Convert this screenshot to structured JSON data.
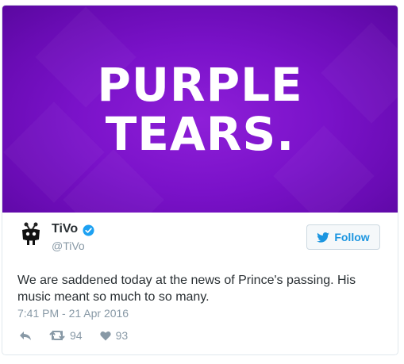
{
  "media": {
    "headline_line1": "PURPLE",
    "headline_line2": "TEARS."
  },
  "author": {
    "name": "TiVo",
    "handle": "@TiVo",
    "verified": true
  },
  "follow_label": "Follow",
  "tweet_text": "We are saddened today at the news of Prince's passing. His music meant so much to so many.",
  "timestamp": "7:41 PM - 21 Apr 2016",
  "actions": {
    "retweets": "94",
    "likes": "93"
  },
  "colors": {
    "media_bg": "#7a12c9",
    "link_blue": "#1b95e0",
    "muted": "#8899a6",
    "text": "#292f33"
  },
  "icons": [
    "tivo-logo-icon",
    "verified-icon",
    "twitter-bird-icon",
    "reply-icon",
    "retweet-icon",
    "heart-icon"
  ]
}
